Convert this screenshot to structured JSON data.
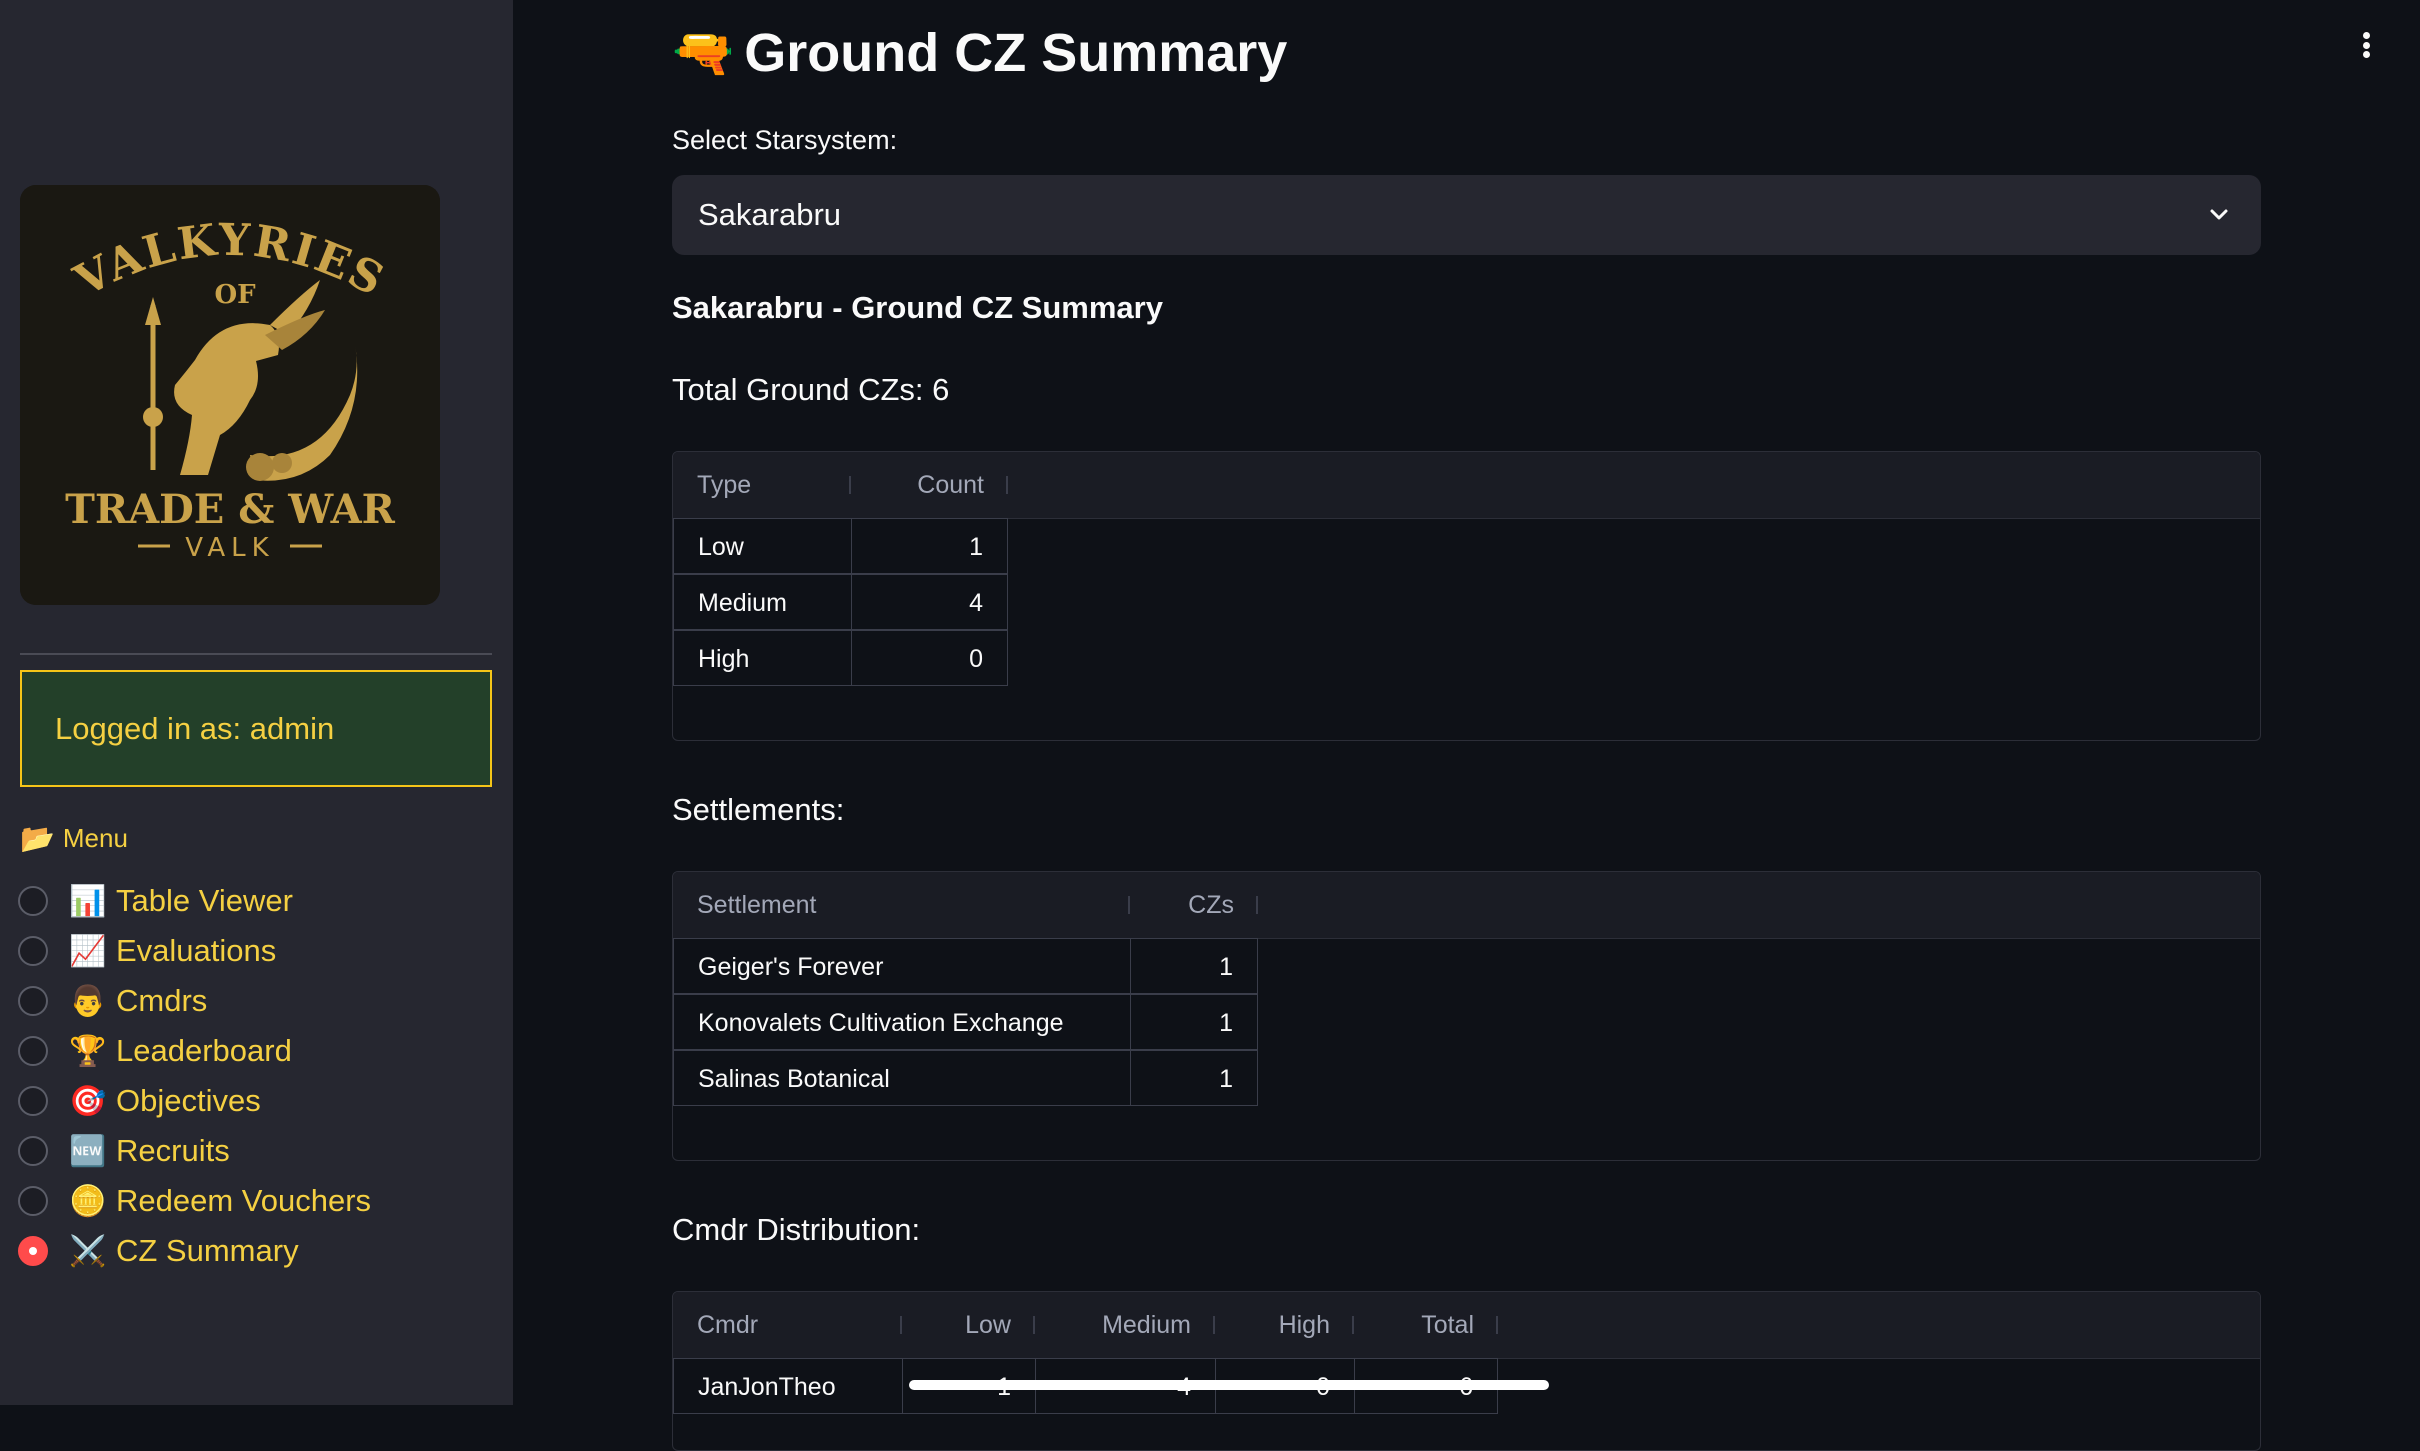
{
  "sidebar": {
    "logo": {
      "line1": "VALKYRIES",
      "line2": "OF",
      "line3": "TRADE & WAR",
      "line4": "VALK"
    },
    "login_text": "Logged in as: admin",
    "menu_icon": "📂",
    "menu_title": "Menu",
    "items": [
      {
        "icon": "📊",
        "icon_name": "bar-chart-icon",
        "label": "Table Viewer",
        "selected": false
      },
      {
        "icon": "📈",
        "icon_name": "trend-chart-icon",
        "label": "Evaluations",
        "selected": false
      },
      {
        "icon": "👨",
        "icon_name": "person-icon",
        "label": "Cmdrs",
        "selected": false
      },
      {
        "icon": "🏆",
        "icon_name": "trophy-icon",
        "label": "Leaderboard",
        "selected": false
      },
      {
        "icon": "🎯",
        "icon_name": "target-icon",
        "label": "Objectives",
        "selected": false
      },
      {
        "icon": "🆕",
        "icon_name": "new-badge-icon",
        "label": "Recruits",
        "selected": false
      },
      {
        "icon": "🪙",
        "icon_name": "coin-icon",
        "label": "Redeem Vouchers",
        "selected": false
      },
      {
        "icon": "⚔️",
        "icon_name": "crossed-swords-icon",
        "label": "CZ Summary",
        "selected": true
      }
    ]
  },
  "main": {
    "title_icon": "🔫",
    "title": "Ground CZ Summary",
    "select_label": "Select Starsystem:",
    "select_value": "Sakarabru",
    "subheading": "Sakarabru - Ground CZ Summary",
    "total_text": "Total Ground CZs: 6",
    "type_table": {
      "headers": [
        "Type",
        "Count"
      ],
      "rows": [
        [
          "Low",
          "1"
        ],
        [
          "Medium",
          "4"
        ],
        [
          "High",
          "0"
        ]
      ]
    },
    "settlements_label": "Settlements:",
    "settlements_table": {
      "headers": [
        "Settlement",
        "CZs"
      ],
      "rows": [
        [
          "Geiger's Forever",
          "1"
        ],
        [
          "Konovalets Cultivation Exchange",
          "1"
        ],
        [
          "Salinas Botanical",
          "1"
        ]
      ]
    },
    "cmdr_label": "Cmdr Distribution:",
    "cmdr_table": {
      "headers": [
        "Cmdr",
        "Low",
        "Medium",
        "High",
        "Total"
      ],
      "rows": [
        [
          "JanJonTheo",
          "1",
          "4",
          "0",
          "6"
        ]
      ]
    }
  },
  "colors": {
    "accent_yellow": "#f5d042",
    "login_bg": "#234029",
    "radio_selected": "#ff4b4b",
    "sidebar_bg": "#262730",
    "main_bg": "#0e1117"
  }
}
